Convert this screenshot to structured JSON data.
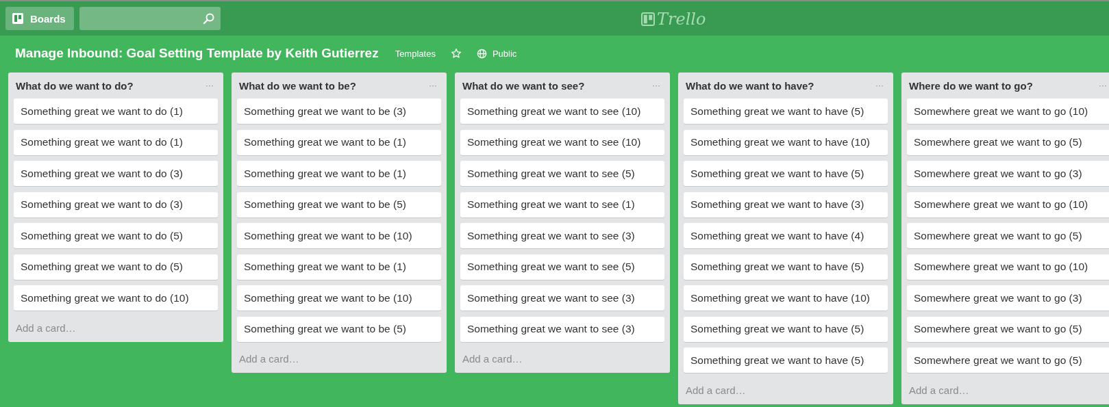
{
  "header": {
    "boards_button": "Boards",
    "logo": "Trello"
  },
  "board": {
    "title": "Manage Inbound: Goal Setting Template by Keith Gutierrez",
    "templates": "Templates",
    "starred": false,
    "visibility": "Public"
  },
  "lists": [
    {
      "title": "What do we want to do?",
      "menu": "···",
      "cards": [
        "Something great we want to do (1)",
        "Something great we want to do (1)",
        "Something great we want to do (3)",
        "Something great we want to do (3)",
        "Something great we want to do (5)",
        "Something great we want to do (5)",
        "Something great we want to do (10)"
      ],
      "add": "Add a card…"
    },
    {
      "title": "What do we want to be?",
      "menu": "···",
      "cards": [
        "Something great we want to be (3)",
        "Something great we want to be (1)",
        "Something great we want to be (1)",
        "Something great we want to be (5)",
        "Something great we want to be (10)",
        "Something great we want to be (1)",
        "Something great we want to be (10)",
        "Something great we want to be (5)"
      ],
      "add": "Add a card…"
    },
    {
      "title": "What do we want to see?",
      "menu": "···",
      "cards": [
        "Something great we want to see (10)",
        "Something great we want to see (10)",
        "Something great we want to see (5)",
        "Something great we want to see (1)",
        "Something great we want to see (3)",
        "Something great we want to see (5)",
        "Something great we want to see (3)",
        "Something great we want to see (3)"
      ],
      "add": "Add a card…"
    },
    {
      "title": "What do we want to have?",
      "menu": "···",
      "cards": [
        "Something great we want to have (5)",
        "Something great we want to have (10)",
        "Something great we want to have (5)",
        "Something great we want to have (3)",
        "Something great we want to have (4)",
        "Something great we want to have (5)",
        "Something great we want to have (10)",
        "Something great we want to have (5)",
        "Something great we want to have (5)"
      ],
      "add": "Add a card…"
    },
    {
      "title": "Where do we want to go?",
      "menu": "···",
      "cards": [
        "Somewhere great we want to go (10)",
        "Somewhere great we want to go (5)",
        "Somewhere great we want to go (3)",
        "Somewhere great we want to go (10)",
        "Somewhere great we want to go (5)",
        "Somewhere great we want to go (10)",
        "Somewhere great we want to go (3)",
        "Somewhere great we want to go (5)",
        "Somewhere great we want to go (5)"
      ],
      "add": "Add a card…"
    }
  ]
}
